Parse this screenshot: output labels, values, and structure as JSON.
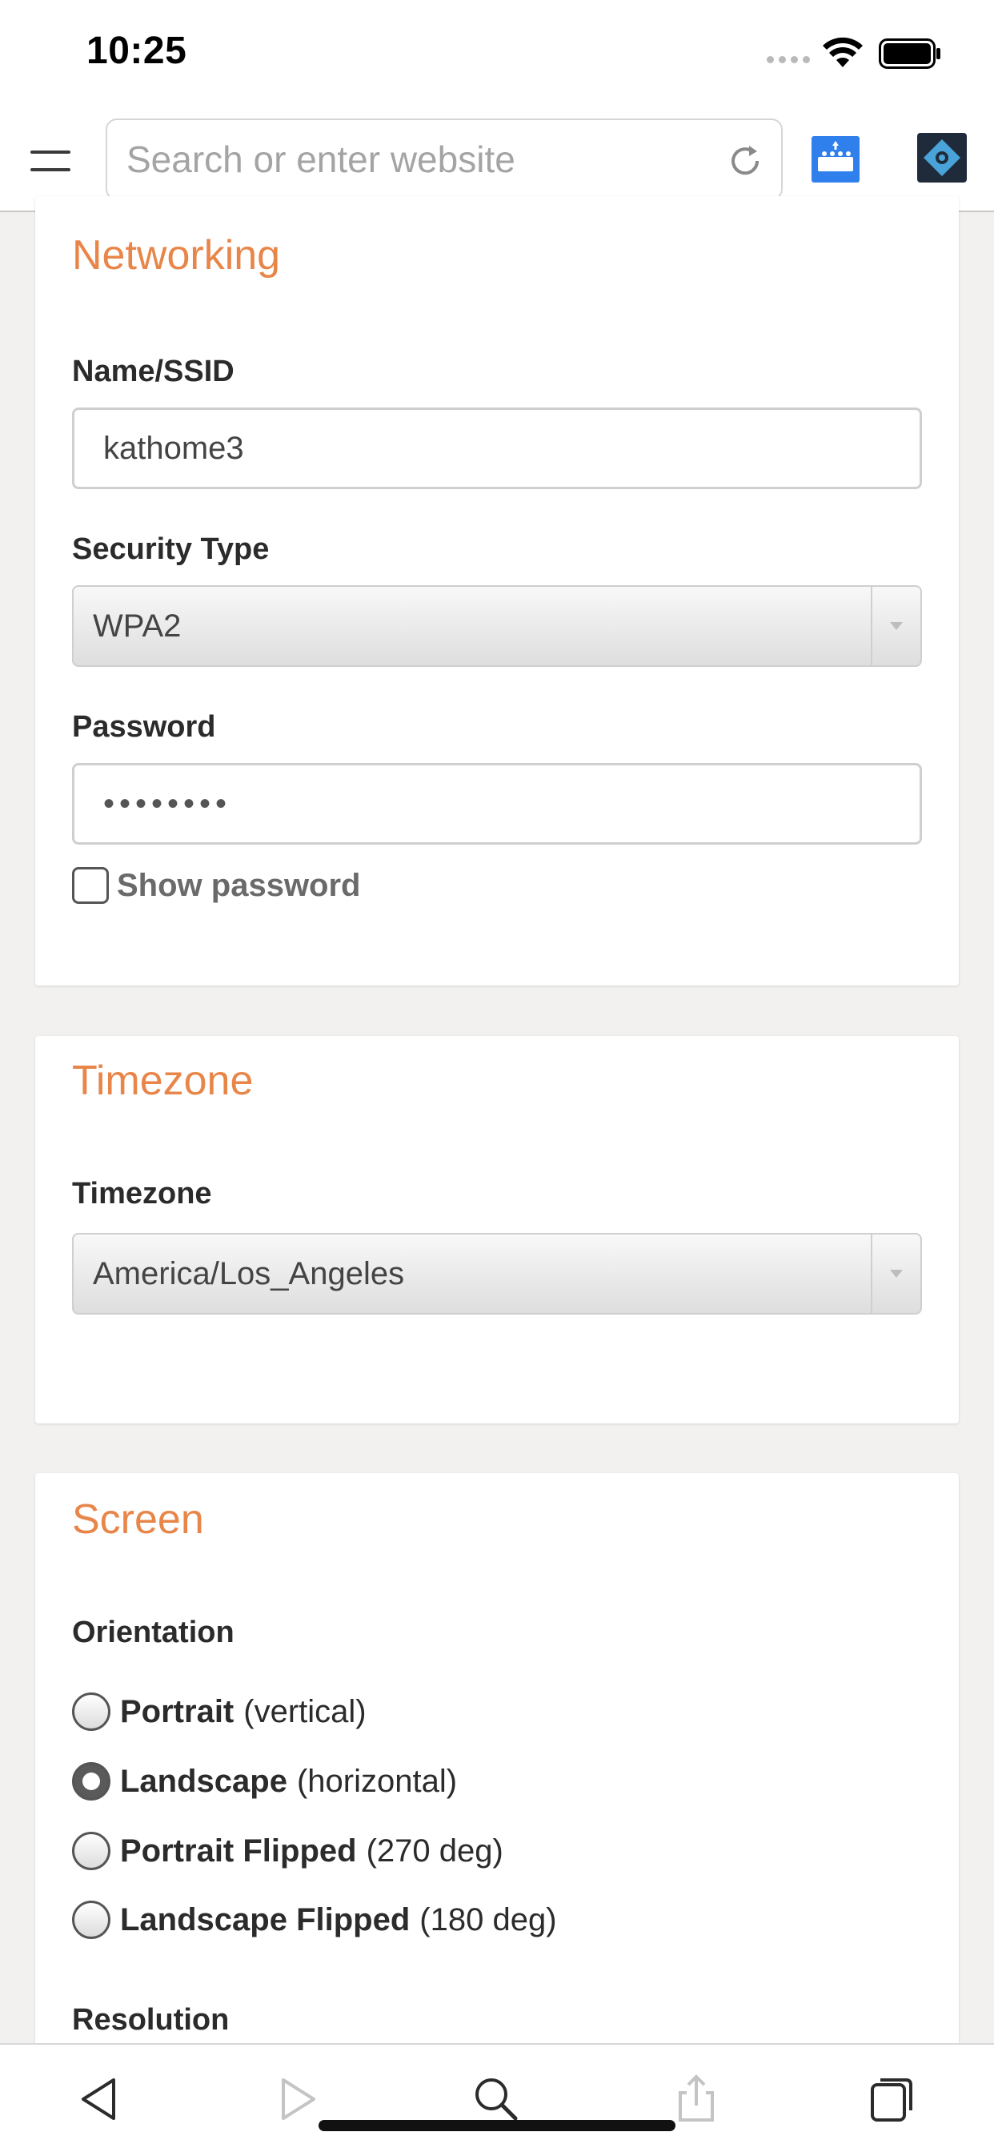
{
  "status_bar": {
    "time": "10:25"
  },
  "toolbar": {
    "search_placeholder": "Search or enter website"
  },
  "networking": {
    "title": "Networking",
    "ssid_label": "Name/SSID",
    "ssid_value": "kathome3",
    "security_label": "Security Type",
    "security_value": "WPA2",
    "password_label": "Password",
    "password_value": "••••••••",
    "show_password_label": "Show password",
    "show_password_checked": false
  },
  "timezone": {
    "title": "Timezone",
    "label": "Timezone",
    "value": "America/Los_Angeles"
  },
  "screen": {
    "title": "Screen",
    "orientation_label": "Orientation",
    "options": [
      {
        "name": "Portrait",
        "detail": "(vertical)",
        "checked": false
      },
      {
        "name": "Landscape",
        "detail": "(horizontal)",
        "checked": true
      },
      {
        "name": "Portrait Flipped",
        "detail": "(270 deg)",
        "checked": false
      },
      {
        "name": "Landscape Flipped",
        "detail": "(180 deg)",
        "checked": false
      }
    ],
    "resolution_label": "Resolution"
  },
  "colors": {
    "section_title": "#e8864a",
    "accent_blue": "#2f80ed"
  },
  "bottom_bar": {
    "icons": [
      "back-icon",
      "forward-icon",
      "search-icon",
      "share-icon",
      "tabs-icon"
    ]
  }
}
